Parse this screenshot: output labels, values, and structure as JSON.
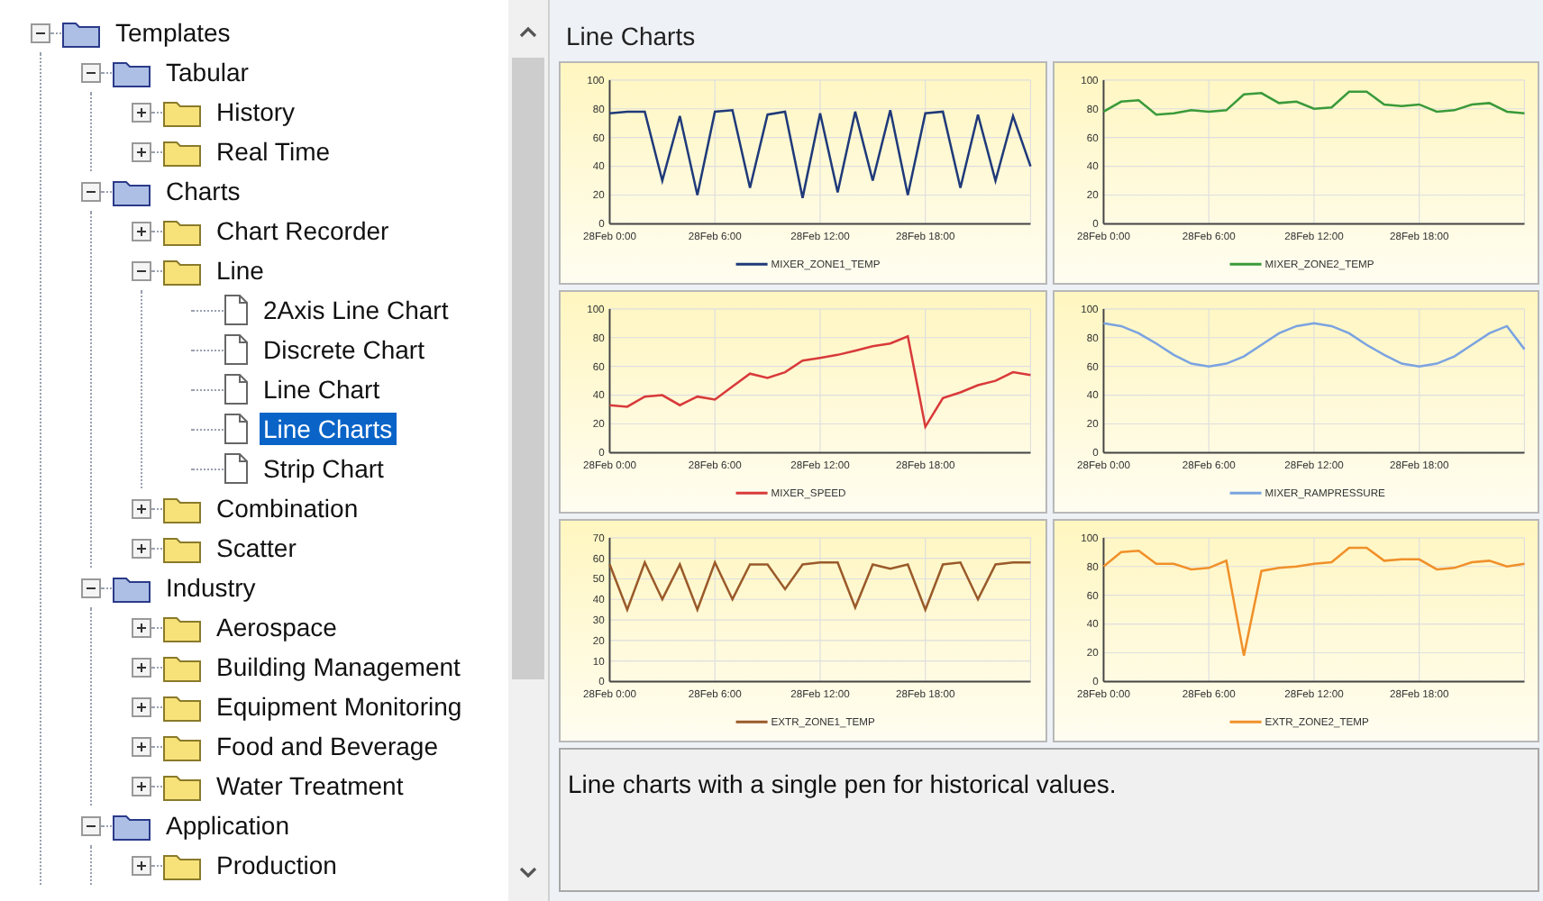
{
  "tree": {
    "items": [
      {
        "label": "Templates",
        "kind": "group",
        "expanded": true,
        "selected": false,
        "children": [
          {
            "label": "Tabular",
            "kind": "group",
            "expanded": true,
            "selected": false,
            "children": [
              {
                "label": "History",
                "kind": "folder",
                "expanded": false,
                "selected": false
              },
              {
                "label": "Real Time",
                "kind": "folder",
                "expanded": false,
                "selected": false
              }
            ]
          },
          {
            "label": "Charts",
            "kind": "group",
            "expanded": true,
            "selected": false,
            "children": [
              {
                "label": "Chart Recorder",
                "kind": "folder",
                "expanded": false,
                "selected": false
              },
              {
                "label": "Line",
                "kind": "folder",
                "expanded": true,
                "selected": false,
                "children": [
                  {
                    "label": "2Axis Line Chart",
                    "kind": "document",
                    "selected": false
                  },
                  {
                    "label": "Discrete Chart",
                    "kind": "document",
                    "selected": false
                  },
                  {
                    "label": "Line Chart",
                    "kind": "document",
                    "selected": false
                  },
                  {
                    "label": "Line Charts",
                    "kind": "document",
                    "selected": true
                  },
                  {
                    "label": "Strip Chart",
                    "kind": "document",
                    "selected": false
                  }
                ]
              },
              {
                "label": "Combination",
                "kind": "folder",
                "expanded": false,
                "selected": false
              },
              {
                "label": "Scatter",
                "kind": "folder",
                "expanded": false,
                "selected": false
              }
            ]
          },
          {
            "label": "Industry",
            "kind": "group",
            "expanded": true,
            "selected": false,
            "children": [
              {
                "label": "Aerospace",
                "kind": "folder",
                "expanded": false,
                "selected": false
              },
              {
                "label": "Building Management",
                "kind": "folder",
                "expanded": false,
                "selected": false
              },
              {
                "label": "Equipment Monitoring",
                "kind": "folder",
                "expanded": false,
                "selected": false
              },
              {
                "label": "Food and Beverage",
                "kind": "folder",
                "expanded": false,
                "selected": false
              },
              {
                "label": "Water Treatment",
                "kind": "folder",
                "expanded": false,
                "selected": false
              }
            ]
          },
          {
            "label": "Application",
            "kind": "group",
            "expanded": true,
            "selected": false,
            "children": [
              {
                "label": "Production",
                "kind": "folder",
                "expanded": false,
                "selected": false
              }
            ]
          }
        ]
      }
    ]
  },
  "preview": {
    "title": "Line Charts",
    "charts": [
      {
        "chart_data": {
          "type": "line",
          "categories": [
            "28Feb 0:00",
            null,
            null,
            null,
            null,
            null,
            "28Feb 6:00",
            null,
            null,
            null,
            null,
            null,
            "28Feb 12:00",
            null,
            null,
            null,
            null,
            null,
            "28Feb 18:00",
            null,
            null,
            null,
            null,
            null,
            null
          ],
          "ylim": [
            0,
            100
          ],
          "yticks": [
            0,
            20,
            40,
            60,
            80,
            100
          ],
          "grid": true,
          "series": [
            {
              "name": "MIXER_ZONE1_TEMP",
              "color": "#1f3a7a",
              "values": [
                77,
                78,
                78,
                30,
                75,
                20,
                78,
                79,
                25,
                76,
                78,
                18,
                77,
                22,
                78,
                30,
                79,
                20,
                77,
                78,
                25,
                76,
                30,
                75,
                40
              ]
            }
          ]
        }
      },
      {
        "chart_data": {
          "type": "line",
          "categories": [
            "28Feb 0:00",
            null,
            null,
            null,
            null,
            null,
            "28Feb 6:00",
            null,
            null,
            null,
            null,
            null,
            "28Feb 12:00",
            null,
            null,
            null,
            null,
            null,
            "28Feb 18:00",
            null,
            null,
            null,
            null,
            null,
            null
          ],
          "ylim": [
            0,
            100
          ],
          "yticks": [
            0,
            20,
            40,
            60,
            80,
            100
          ],
          "grid": true,
          "series": [
            {
              "name": "MIXER_ZONE2_TEMP",
              "color": "#3a9a3a",
              "values": [
                78,
                85,
                86,
                76,
                77,
                79,
                78,
                79,
                90,
                91,
                84,
                85,
                80,
                81,
                92,
                92,
                83,
                82,
                83,
                78,
                79,
                83,
                84,
                78,
                77
              ]
            }
          ]
        }
      },
      {
        "chart_data": {
          "type": "line",
          "categories": [
            "28Feb 0:00",
            null,
            null,
            null,
            null,
            null,
            "28Feb 6:00",
            null,
            null,
            null,
            null,
            null,
            "28Feb 12:00",
            null,
            null,
            null,
            null,
            null,
            "28Feb 18:00",
            null,
            null,
            null,
            null,
            null,
            null
          ],
          "ylim": [
            0,
            100
          ],
          "yticks": [
            0,
            20,
            40,
            60,
            80,
            100
          ],
          "grid": true,
          "series": [
            {
              "name": "MIXER_SPEED",
              "color": "#d83a3a",
              "values": [
                33,
                32,
                39,
                40,
                33,
                39,
                37,
                46,
                55,
                52,
                56,
                64,
                66,
                68,
                71,
                74,
                76,
                81,
                18,
                38,
                42,
                47,
                50,
                56,
                54
              ]
            }
          ]
        }
      },
      {
        "chart_data": {
          "type": "line",
          "categories": [
            "28Feb 0:00",
            null,
            null,
            null,
            null,
            null,
            "28Feb 6:00",
            null,
            null,
            null,
            null,
            null,
            "28Feb 12:00",
            null,
            null,
            null,
            null,
            null,
            "28Feb 18:00",
            null,
            null,
            null,
            null,
            null,
            null
          ],
          "ylim": [
            0,
            100
          ],
          "yticks": [
            0,
            20,
            40,
            60,
            80,
            100
          ],
          "grid": true,
          "series": [
            {
              "name": "MIXER_RAMPRESSURE",
              "color": "#7aa3e0",
              "values": [
                90,
                88,
                83,
                76,
                68,
                62,
                60,
                62,
                67,
                75,
                83,
                88,
                90,
                88,
                83,
                75,
                68,
                62,
                60,
                62,
                67,
                75,
                83,
                88,
                72
              ]
            }
          ]
        }
      },
      {
        "chart_data": {
          "type": "line",
          "categories": [
            "28Feb 0:00",
            null,
            null,
            null,
            null,
            null,
            "28Feb 6:00",
            null,
            null,
            null,
            null,
            null,
            "28Feb 12:00",
            null,
            null,
            null,
            null,
            null,
            "28Feb 18:00",
            null,
            null,
            null,
            null,
            null,
            null
          ],
          "ylim": [
            0,
            70
          ],
          "yticks": [
            0,
            10,
            20,
            30,
            40,
            50,
            60,
            70
          ],
          "grid": true,
          "series": [
            {
              "name": "EXTR_ZONE1_TEMP",
              "color": "#9a5a2a",
              "values": [
                57,
                35,
                58,
                40,
                57,
                35,
                58,
                40,
                57,
                57,
                45,
                57,
                58,
                58,
                36,
                57,
                55,
                57,
                35,
                57,
                58,
                40,
                57,
                58,
                58
              ]
            }
          ]
        }
      },
      {
        "chart_data": {
          "type": "line",
          "categories": [
            "28Feb 0:00",
            null,
            null,
            null,
            null,
            null,
            "28Feb 6:00",
            null,
            null,
            null,
            null,
            null,
            "28Feb 12:00",
            null,
            null,
            null,
            null,
            null,
            "28Feb 18:00",
            null,
            null,
            null,
            null,
            null,
            null
          ],
          "ylim": [
            0,
            100
          ],
          "yticks": [
            0,
            20,
            40,
            60,
            80,
            100
          ],
          "grid": true,
          "series": [
            {
              "name": "EXTR_ZONE2_TEMP",
              "color": "#f0902a",
              "values": [
                80,
                90,
                91,
                82,
                82,
                78,
                79,
                84,
                18,
                77,
                79,
                80,
                82,
                83,
                93,
                93,
                84,
                85,
                85,
                78,
                79,
                83,
                84,
                80,
                82
              ]
            }
          ]
        }
      }
    ],
    "description": "Line charts with a single pen for historical values."
  }
}
